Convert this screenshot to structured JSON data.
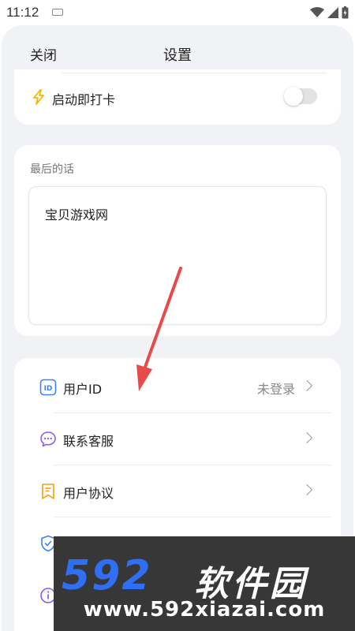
{
  "status_bar": {
    "time": "11:12"
  },
  "header": {
    "close_label": "关闭",
    "title": "设置"
  },
  "settings": {
    "auto_punch_label": "启动即打卡",
    "auto_punch_enabled": false
  },
  "last_words": {
    "label": "最后的话",
    "text": "宝贝游戏网"
  },
  "menu": {
    "items": [
      {
        "icon": "id-icon",
        "label": "用户ID",
        "value": "未登录",
        "icon_color": "#3b82f6"
      },
      {
        "icon": "chat-bubble-icon",
        "label": "联系客服",
        "value": "",
        "icon_color": "#8b5cf6"
      },
      {
        "icon": "bookmark-doc-icon",
        "label": "用户协议",
        "value": "",
        "icon_color": "#f59e0b"
      },
      {
        "icon": "shield-check-icon",
        "label": "",
        "value": "",
        "icon_color": "#3b82f6"
      },
      {
        "icon": "info-icon",
        "label": "",
        "value": "",
        "icon_color": "#8b5cf6"
      }
    ]
  },
  "watermark": {
    "number": "592",
    "cn": "软件园",
    "url": "www.592xiazai.com"
  },
  "colors": {
    "accent_bolt": "#f5b800",
    "annotation_arrow": "#e84a4a",
    "background": "#f1f2f6"
  }
}
